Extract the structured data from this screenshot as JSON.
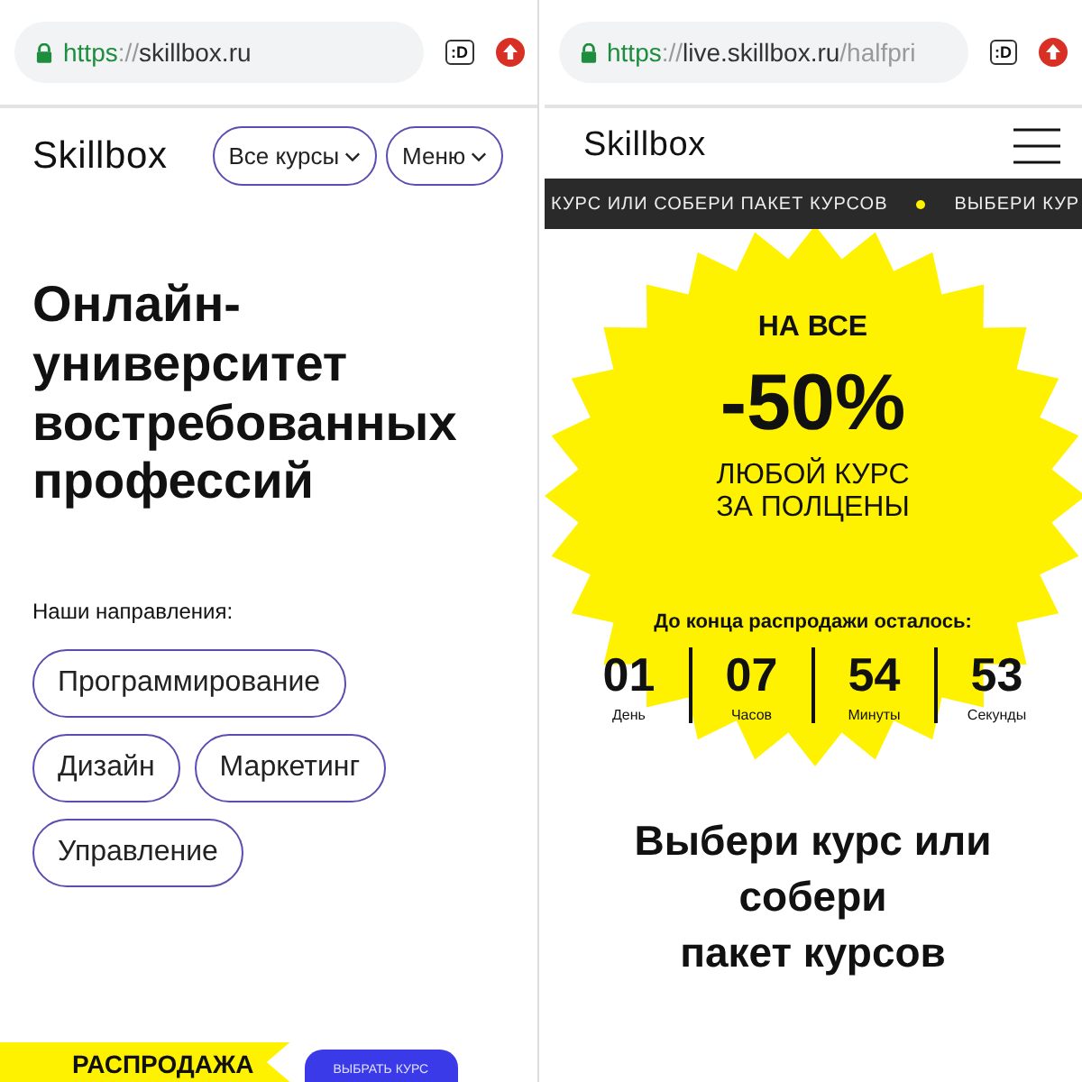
{
  "left": {
    "browser": {
      "scheme": "https",
      "separator": "://",
      "host": "skillbox.ru",
      "tabs_label": ":D"
    },
    "header": {
      "logo": "Skillbox",
      "buttons": [
        "Все курсы",
        "Меню"
      ]
    },
    "hero": {
      "title": "Онлайн-\nуниверситет\nвостребованных\nпрофессий"
    },
    "directions": {
      "label": "Наши направления:",
      "tags": [
        "Программирование",
        "Дизайн",
        "Маркетинг",
        "Управление"
      ]
    },
    "bottom": {
      "ribbon": "РАСПРОДАЖА",
      "button": "ВЫБРАТЬ КУРС"
    }
  },
  "right": {
    "browser": {
      "scheme": "https",
      "separator": "://",
      "host": "live.skillbox.ru",
      "path": "/halfpri",
      "tabs_label": ":D"
    },
    "header": {
      "logo": "Skillbox"
    },
    "ticker": [
      "КУРС ИЛИ СОБЕРИ ПАКЕТ КУРСОВ",
      "ВЫБЕРИ КУР"
    ],
    "promo": {
      "top": "НА ВСЕ",
      "discount": "-50%",
      "bottom": "ЛЮБОЙ КУРС\nЗА ПОЛЦЕНЫ"
    },
    "countdown": {
      "label": "До конца распродажи осталось:",
      "units": [
        {
          "value": "01",
          "label": "День"
        },
        {
          "value": "07",
          "label": "Часов"
        },
        {
          "value": "54",
          "label": "Минуты"
        },
        {
          "value": "53",
          "label": "Секунды"
        }
      ]
    },
    "heading": "Выбери курс или\nсобери\nпакет курсов"
  }
}
